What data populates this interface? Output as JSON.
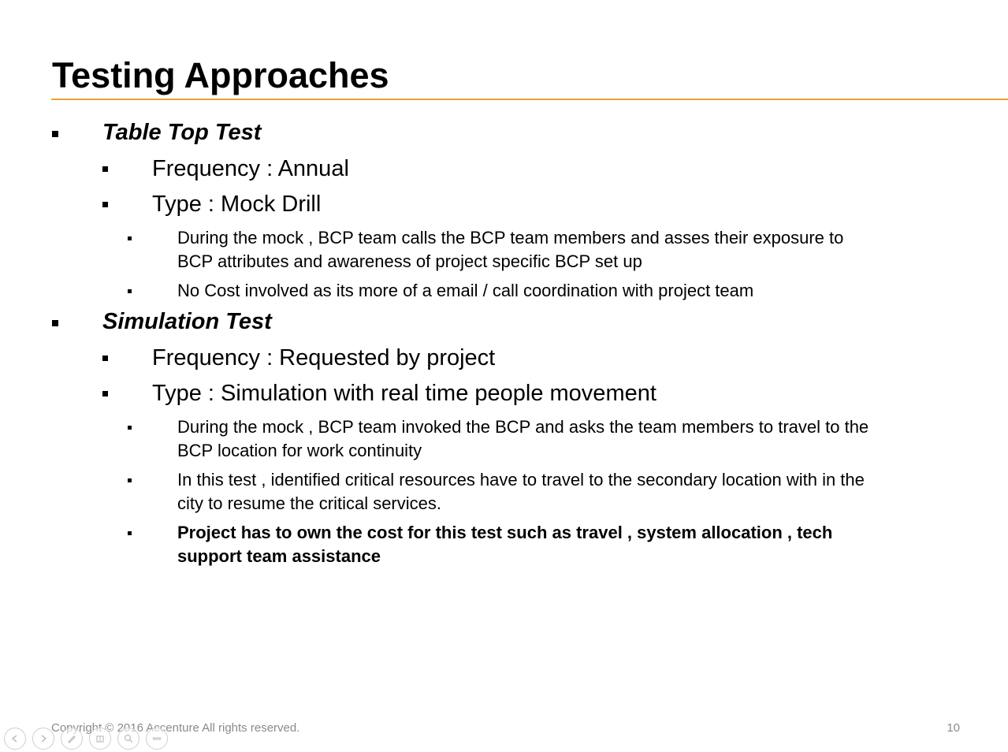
{
  "slide": {
    "title": "Testing Approaches",
    "sections": [
      {
        "heading": "Table Top Test",
        "frequency": "Frequency : Annual",
        "type": "Type : Mock Drill",
        "details": [
          {
            "line1": "During the mock , BCP team calls the BCP team members and asses their exposure to",
            "line2": "BCP attributes and awareness of project specific BCP set up"
          },
          {
            "line1": "No Cost involved as its more of a email / call coordination with project team"
          }
        ]
      },
      {
        "heading": "Simulation Test",
        "frequency": "Frequency : Requested by project",
        "type": "Type : Simulation with real time people movement",
        "details": [
          {
            "line1": "During the mock , BCP team invoked the BCP and asks the team members to travel to the",
            "line2": "BCP location for work continuity"
          },
          {
            "line1": "In this test , identified critical resources have to travel to the secondary location with in the",
            "line2": "city to resume the critical services."
          },
          {
            "line1": "Project has to own the cost for this test such as travel , system allocation , tech",
            "line2": "support team assistance"
          }
        ]
      }
    ],
    "footer": {
      "copyright": "Copyright © 2016 Accenture  All rights reserved.",
      "page_number": "10"
    }
  },
  "colors": {
    "accent_rule": "#e8a33a",
    "footer_text": "#8a8a8a"
  },
  "toolbar": {
    "icons": [
      "previous-icon",
      "next-icon",
      "pen-icon",
      "slides-icon",
      "zoom-icon",
      "more-icon"
    ]
  }
}
